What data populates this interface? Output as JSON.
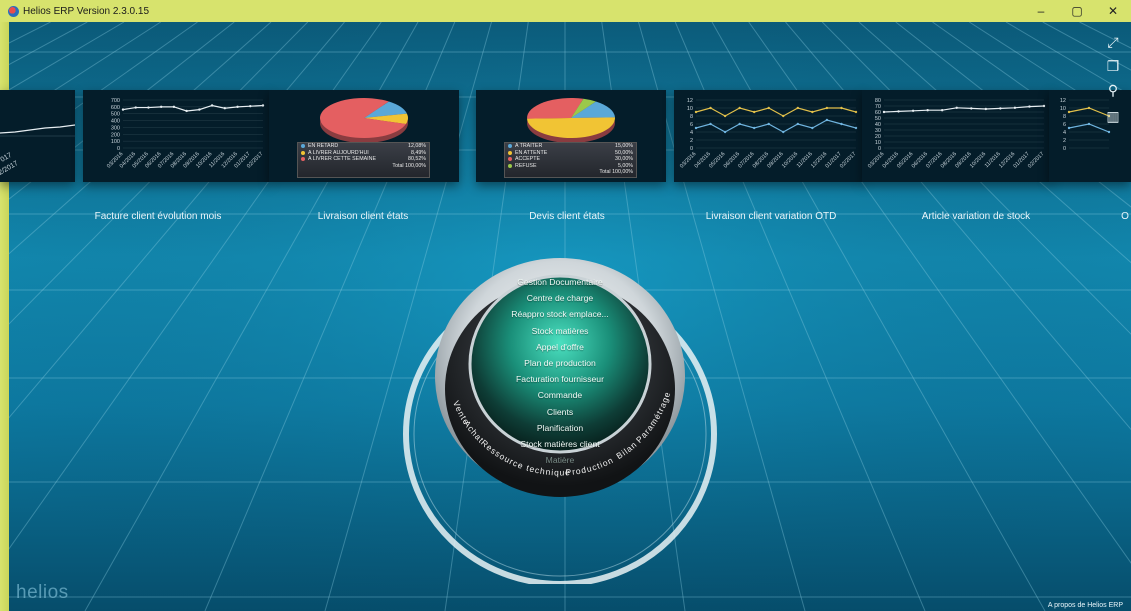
{
  "window": {
    "title": "Helios ERP Version 2.3.0.15",
    "controls": [
      "–",
      "▢",
      "✕"
    ]
  },
  "tiles": [
    {
      "label": "Facture client évolution mois",
      "chart_data": {
        "type": "line",
        "ylim": [
          0,
          700
        ],
        "yticks": [
          "0",
          "100",
          "200",
          "300",
          "400",
          "500",
          "600",
          "700"
        ],
        "categories": [
          "03/2016",
          "04/2016",
          "05/2016",
          "06/2016",
          "07/2016",
          "08/2016",
          "09/2016",
          "10/2016",
          "11/2016",
          "12/2016",
          "01/2017",
          "02/2017"
        ],
        "series": [
          {
            "values": [
              560,
              590,
              590,
              600,
              600,
              540,
              560,
              620,
              580,
              600,
              610,
              620
            ],
            "color": "#e7eef2"
          }
        ]
      }
    },
    {
      "label": "Livraison client états",
      "chart_data": {
        "type": "pie",
        "slices": [
          {
            "label": "EN RETARD",
            "percent": "12,08%",
            "value": 12.08,
            "color": "#5aa8d8"
          },
          {
            "label": "A LIVRER AUJOURD'HUI",
            "percent": "8,49%",
            "value": 8.49,
            "color": "#f1c434"
          },
          {
            "label": "A LIVRER CETTE SEMAINE",
            "percent": "80,52%",
            "value": 80.52,
            "color": "#e45f61"
          }
        ],
        "total": "Total 100,00%"
      }
    },
    {
      "label": "Devis client états",
      "chart_data": {
        "type": "pie",
        "slices": [
          {
            "label": "A TRAITER",
            "percent": "15,00%",
            "value": 15,
            "color": "#5aa8d8"
          },
          {
            "label": "EN ATTENTE",
            "percent": "50,00%",
            "value": 50,
            "color": "#f1c434"
          },
          {
            "label": "ACCEPTE",
            "percent": "30,00%",
            "value": 30,
            "color": "#e45f61"
          },
          {
            "label": "REFUSE",
            "percent": "5,00%",
            "value": 5,
            "color": "#9bc84a"
          }
        ],
        "total": "Total 100,00%"
      }
    },
    {
      "label": "Livraison client variation OTD",
      "chart_data": {
        "type": "line",
        "ylim": [
          0,
          12
        ],
        "yticks": [
          "0",
          "2",
          "4",
          "6",
          "8",
          "10",
          "12"
        ],
        "categories": [
          "03/2016",
          "04/2016",
          "05/2016",
          "06/2016",
          "07/2016",
          "08/2016",
          "09/2016",
          "10/2016",
          "11/2016",
          "12/2016",
          "01/2017",
          "02/2017"
        ],
        "series": [
          {
            "values": [
              9,
              10,
              8,
              10,
              9,
              10,
              8,
              10,
              9,
              10,
              10,
              9
            ],
            "color": "#e2c04a"
          },
          {
            "values": [
              5,
              6,
              4,
              6,
              5,
              6,
              4,
              6,
              5,
              7,
              6,
              5
            ],
            "color": "#6fb4df"
          }
        ]
      }
    },
    {
      "label": "Article variation de stock",
      "chart_data": {
        "type": "line",
        "ylim": [
          0,
          80
        ],
        "yticks": [
          "0",
          "10",
          "20",
          "30",
          "40",
          "50",
          "60",
          "70",
          "80"
        ],
        "categories": [
          "03/2016",
          "04/2016",
          "05/2016",
          "06/2016",
          "07/2016",
          "08/2016",
          "09/2016",
          "10/2016",
          "11/2016",
          "12/2016",
          "01/2017",
          "02/2017"
        ],
        "series": [
          {
            "values": [
              60,
              61,
              62,
              63,
              63,
              67,
              66,
              65,
              66,
              67,
              69,
              70
            ],
            "color": "#e7eef2"
          }
        ]
      }
    },
    {
      "label": "O",
      "chart_data": {
        "type": "line",
        "ylim": [
          0,
          12
        ],
        "yticks": [
          "0",
          "2",
          "4",
          "6",
          "8",
          "10",
          "12"
        ],
        "categories": [],
        "series": [
          {
            "values": [
              9,
              10,
              8
            ],
            "color": "#e2c04a"
          },
          {
            "values": [
              5,
              6,
              4
            ],
            "color": "#6fb4df"
          }
        ]
      }
    }
  ],
  "left_partial": {
    "ticks": [
      "017",
      "2/2017"
    ]
  },
  "toolbar": [
    {
      "name": "fullscreen-icon",
      "glyph": "⤢"
    },
    {
      "name": "windows-icon",
      "glyph": "❐"
    },
    {
      "name": "search-icon",
      "glyph": "⚲"
    },
    {
      "name": "dashboard-icon",
      "glyph": "▥"
    }
  ],
  "menu": {
    "items": [
      "Gestion Documentaire",
      "Centre de charge",
      "Réappro stock emplace...",
      "Stock matières",
      "Appel d'offre",
      "Plan de production",
      "Facturation fournisseur",
      "Commande",
      "Clients",
      "Planification",
      "Stock matières client",
      "Matière"
    ],
    "ring_labels": [
      "Vente",
      "Achat",
      "Ressource technique",
      "Production",
      "Bilan",
      "Paramétrage"
    ]
  },
  "brand": "helios",
  "footer": {
    "about": "A propos de Helios ERP"
  }
}
